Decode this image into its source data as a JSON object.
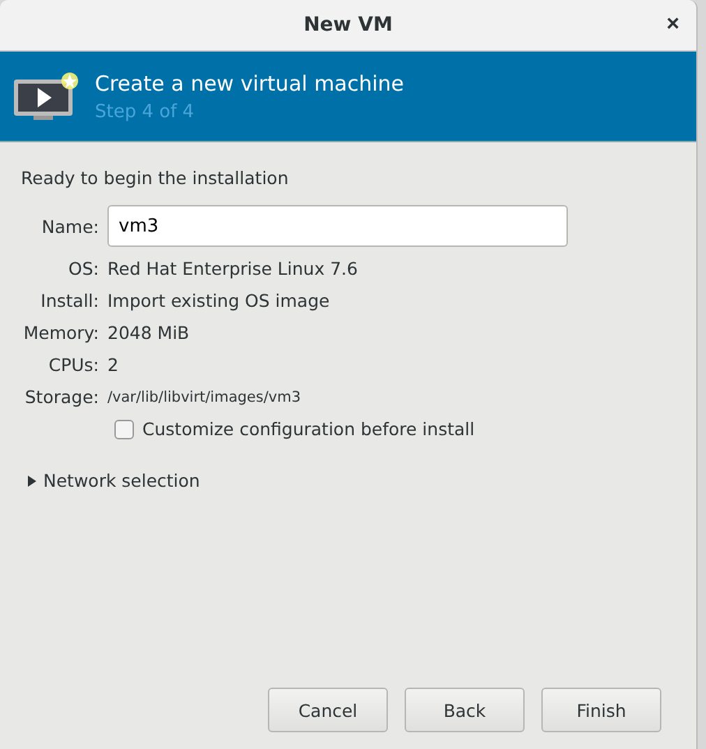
{
  "window": {
    "title": "New VM",
    "close": "×"
  },
  "header": {
    "title": "Create a new virtual machine",
    "subtitle": "Step 4 of 4"
  },
  "intro": "Ready to begin the installation",
  "fields": [
    {
      "kind": "entry",
      "label": "Name:",
      "value": "vm3"
    },
    {
      "kind": "text",
      "label": "OS:",
      "value": "Red Hat Enterprise Linux 7.6"
    },
    {
      "kind": "text",
      "label": "Install:",
      "value": "Import existing OS image"
    },
    {
      "kind": "text",
      "label": "Memory:",
      "value": "2048 MiB"
    },
    {
      "kind": "text",
      "label": "CPUs:",
      "value": "2"
    },
    {
      "kind": "path",
      "label": "Storage:",
      "value": "/var/lib/libvirt/images/vm3"
    }
  ],
  "customize": {
    "label": "Customize configuration before install",
    "checked": false
  },
  "network": {
    "label": "Network selection",
    "expanded": false
  },
  "buttons": [
    "Cancel",
    "Back",
    "Finish"
  ]
}
